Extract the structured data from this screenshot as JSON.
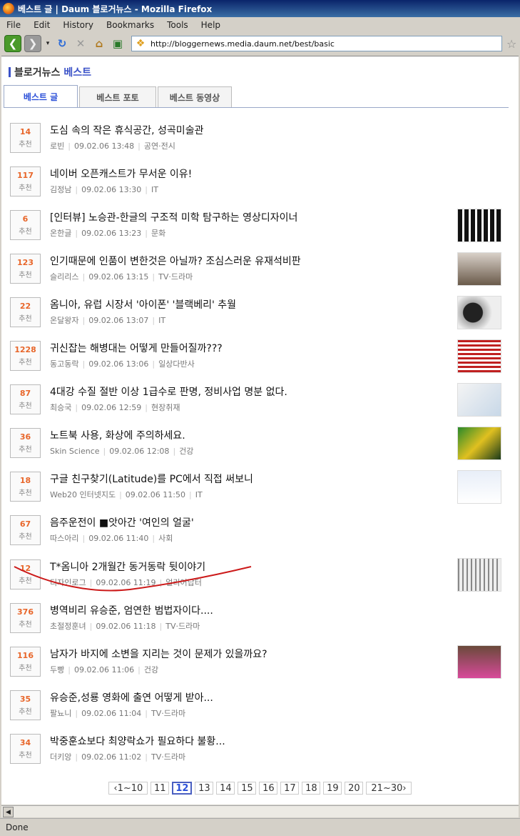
{
  "window": {
    "title": "베스트 글 | Daum 블로거뉴스 - Mozilla Firefox"
  },
  "menu": [
    "File",
    "Edit",
    "History",
    "Bookmarks",
    "Tools",
    "Help"
  ],
  "address": {
    "url": "http://bloggernews.media.daum.net/best/basic"
  },
  "page": {
    "title_main": "블로거뉴스",
    "title_accent": "베스트"
  },
  "tabs": [
    {
      "label": "베스트 글"
    },
    {
      "label": "베스트 포토"
    },
    {
      "label": "베스트 동영상"
    }
  ],
  "rec_label": "추천",
  "articles": [
    {
      "count": "14",
      "title": "도심 속의 작은 휴식공간, 성곡미술관",
      "author": "로빈",
      "date": "09.02.06 13:48",
      "category": "공연·전시"
    },
    {
      "count": "117",
      "title": "네이버 오픈캐스트가 무서운 이유!",
      "author": "김정남",
      "date": "09.02.06 13:30",
      "category": "IT"
    },
    {
      "count": "6",
      "title": "[인터뷰] 노승관-한글의 구조적 미학 탐구하는 영상디자이너",
      "author": "온한글",
      "date": "09.02.06 13:23",
      "category": "문화"
    },
    {
      "count": "123",
      "title": "인기때문에 인품이 변한것은 아닐까? 조심스러운 유재석비판",
      "author": "슬리리스",
      "date": "09.02.06 13:15",
      "category": "TV·드라마"
    },
    {
      "count": "22",
      "title": "옴니아, 유럽 시장서 '아이폰' '블랙베리' 추월",
      "author": "온달왕자",
      "date": "09.02.06 13:07",
      "category": "IT"
    },
    {
      "count": "1228",
      "title": "귀신잡는 해병대는 어떻게 만들어질까???",
      "author": "동고동락",
      "date": "09.02.06 13:06",
      "category": "일상다반사"
    },
    {
      "count": "87",
      "title": "4대강 수질 절반 이상 1급수로 판명, 정비사업 명분 없다.",
      "author": "최승국",
      "date": "09.02.06 12:59",
      "category": "현장취재"
    },
    {
      "count": "36",
      "title": "노트북 사용, 화상에 주의하세요.",
      "author": "Skin Science",
      "date": "09.02.06 12:08",
      "category": "건강"
    },
    {
      "count": "18",
      "title": "구글 친구찾기(Latitude)를 PC에서 직접 써보니",
      "author": "Web20 인터넷지도",
      "date": "09.02.06 11:50",
      "category": "IT"
    },
    {
      "count": "67",
      "title": "음주운전이 ■앗아간 '여인의 얼굴'",
      "author": "따스아리",
      "date": "09.02.06 11:40",
      "category": "사회"
    },
    {
      "count": "12",
      "title": "T*옴니아 2개월간 동거동락 뒷이야기",
      "author": "디자인로그",
      "date": "09.02.06 11:19",
      "category": "얼리어답터"
    },
    {
      "count": "376",
      "title": "병역비리 유승준, 엄연한 범법자이다....",
      "author": "초절정훈녀",
      "date": "09.02.06 11:18",
      "category": "TV·드라마"
    },
    {
      "count": "116",
      "title": "남자가 바지에 소변을 지리는 것이 문제가 있을까요?",
      "author": "두빵",
      "date": "09.02.06 11:06",
      "category": "건강"
    },
    {
      "count": "35",
      "title": "유승준,성룡 영화에 출연 어떻게 받아...",
      "author": "팔뇨니",
      "date": "09.02.06 11:04",
      "category": "TV·드라마"
    },
    {
      "count": "34",
      "title": "박중훈쇼보다 최양락쇼가 필요하다 불황...",
      "author": "더키앙",
      "date": "09.02.06 11:02",
      "category": "TV·드라마"
    }
  ],
  "pager": {
    "prev": "1~10",
    "pages": [
      "11",
      "12",
      "13",
      "14",
      "15",
      "16",
      "17",
      "18",
      "19",
      "20"
    ],
    "current": "12",
    "next": "21~30"
  },
  "status": {
    "text": "Done"
  },
  "colors": {
    "accent": "#3b52c8",
    "count": "#e8662a",
    "annotation": "#cc1a1a"
  }
}
